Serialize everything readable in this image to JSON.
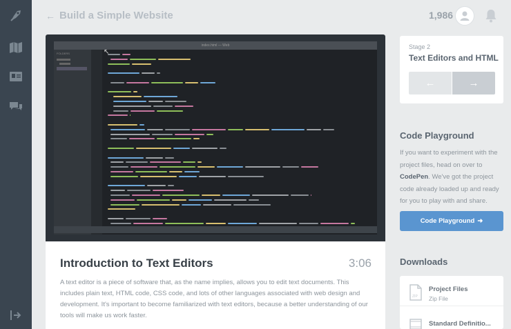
{
  "header": {
    "back_label": "Build a Simple Website",
    "points": "1,986"
  },
  "sidebar": {
    "icons": [
      "rocket-icon",
      "map-icon",
      "profile-card-icon",
      "chat-icon",
      "sign-out-icon"
    ]
  },
  "video": {
    "editor_title": "index.html — Web",
    "folders_label": "FOLDERS"
  },
  "lesson": {
    "title": "Introduction to Text Editors",
    "duration": "3:06",
    "description": "A text editor is a piece of software that, as the name implies, allows you to edit text documents. This includes plain text, HTML code, CSS code, and lots of other languages associated with web design and development. It's important to become familiarized with text editors, because a better understanding of our tools will make us work faster."
  },
  "stage": {
    "label": "Stage 2",
    "name": "Text Editors and HTML"
  },
  "playground": {
    "heading": "Code Playground",
    "text_before": "If you want to experiment with the project files, head on over to ",
    "link": "CodePen",
    "text_after": ". We've got the project code already loaded up and ready for you to play with and share.",
    "button_label": "Code Playground"
  },
  "downloads": {
    "heading": "Downloads",
    "items": [
      {
        "name": "Project Files",
        "type": "Zip File"
      },
      {
        "name": "Standard Definitio...",
        "type": ""
      }
    ]
  },
  "colors": {
    "sidebar": "#3a4550",
    "accent": "#5a95d0",
    "background": "#e9ebec"
  }
}
